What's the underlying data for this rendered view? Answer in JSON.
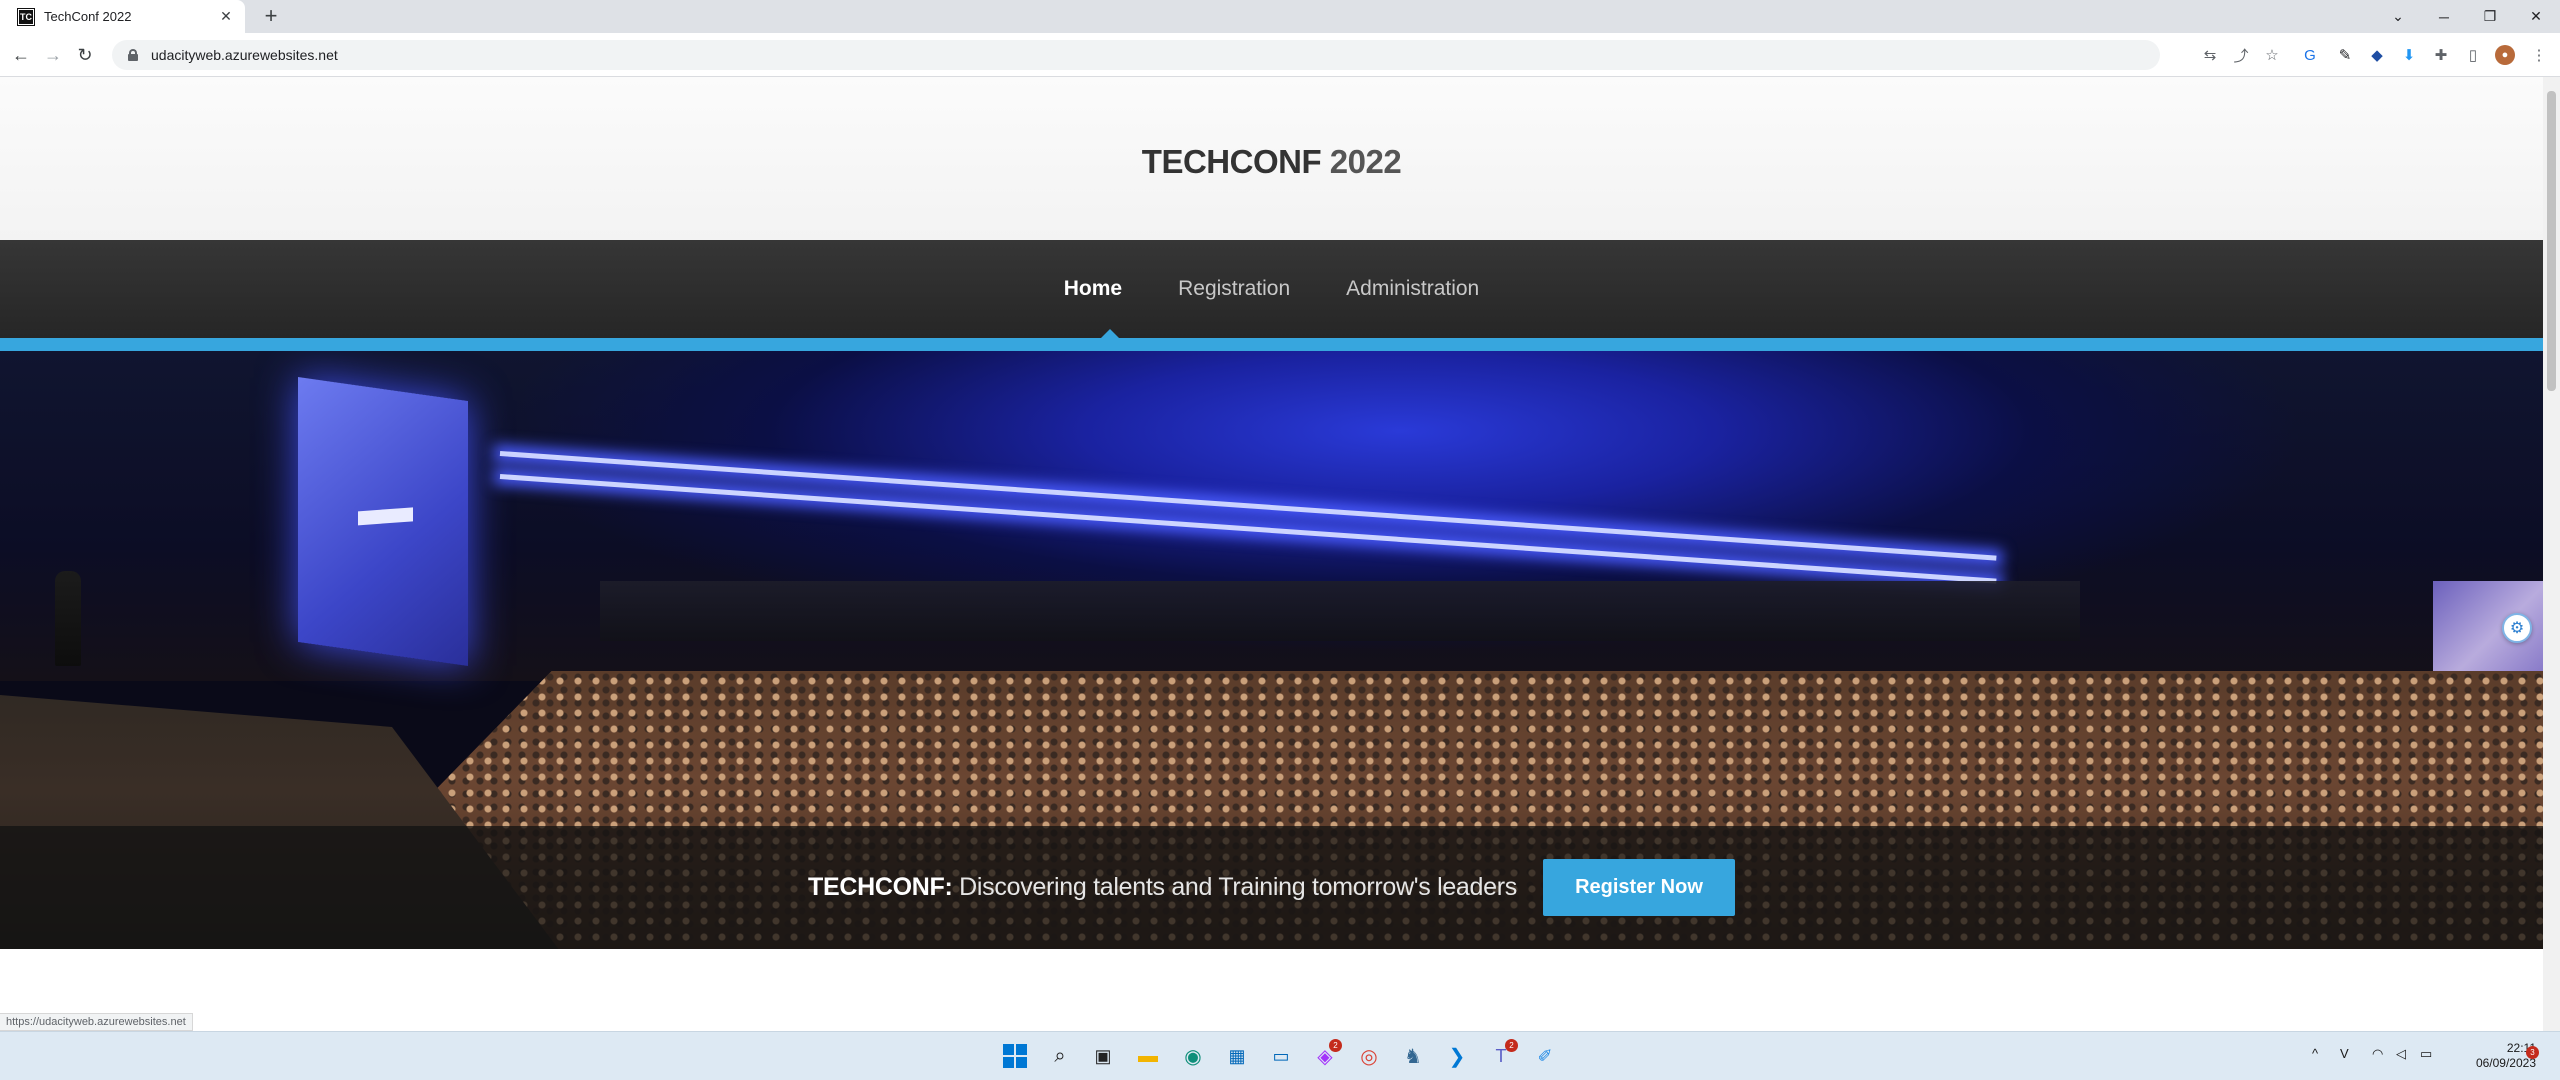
{
  "browser": {
    "tab_title": "TechConf 2022",
    "tab_favicon_text": "TC",
    "url": "udacityweb.azurewebsites.net",
    "status_url": "https://udacityweb.azurewebsites.net"
  },
  "site": {
    "title_brand": "TECHCONF",
    "title_year": " 2022",
    "nav": [
      {
        "label": "Home",
        "active": true
      },
      {
        "label": "Registration",
        "active": false
      },
      {
        "label": "Administration",
        "active": false
      }
    ],
    "tagline_brand": "TECHCONF:",
    "tagline_text": " Discovering talents and Training tomorrow's leaders",
    "register_button": "Register Now"
  },
  "colors": {
    "accent": "#37a6de",
    "nav_bg": "#2e2e2e"
  },
  "taskbar": {
    "apps": [
      "windows-start",
      "search",
      "task-view",
      "file-explorer",
      "edge",
      "microsoft-store",
      "remote-desktop",
      "messenger",
      "chrome",
      "pgadmin",
      "vscode",
      "teams",
      "paint"
    ],
    "messenger_badge": "2",
    "teams_badge": "2",
    "time": "22:11",
    "date": "06/09/2023",
    "notification_count": "3"
  }
}
